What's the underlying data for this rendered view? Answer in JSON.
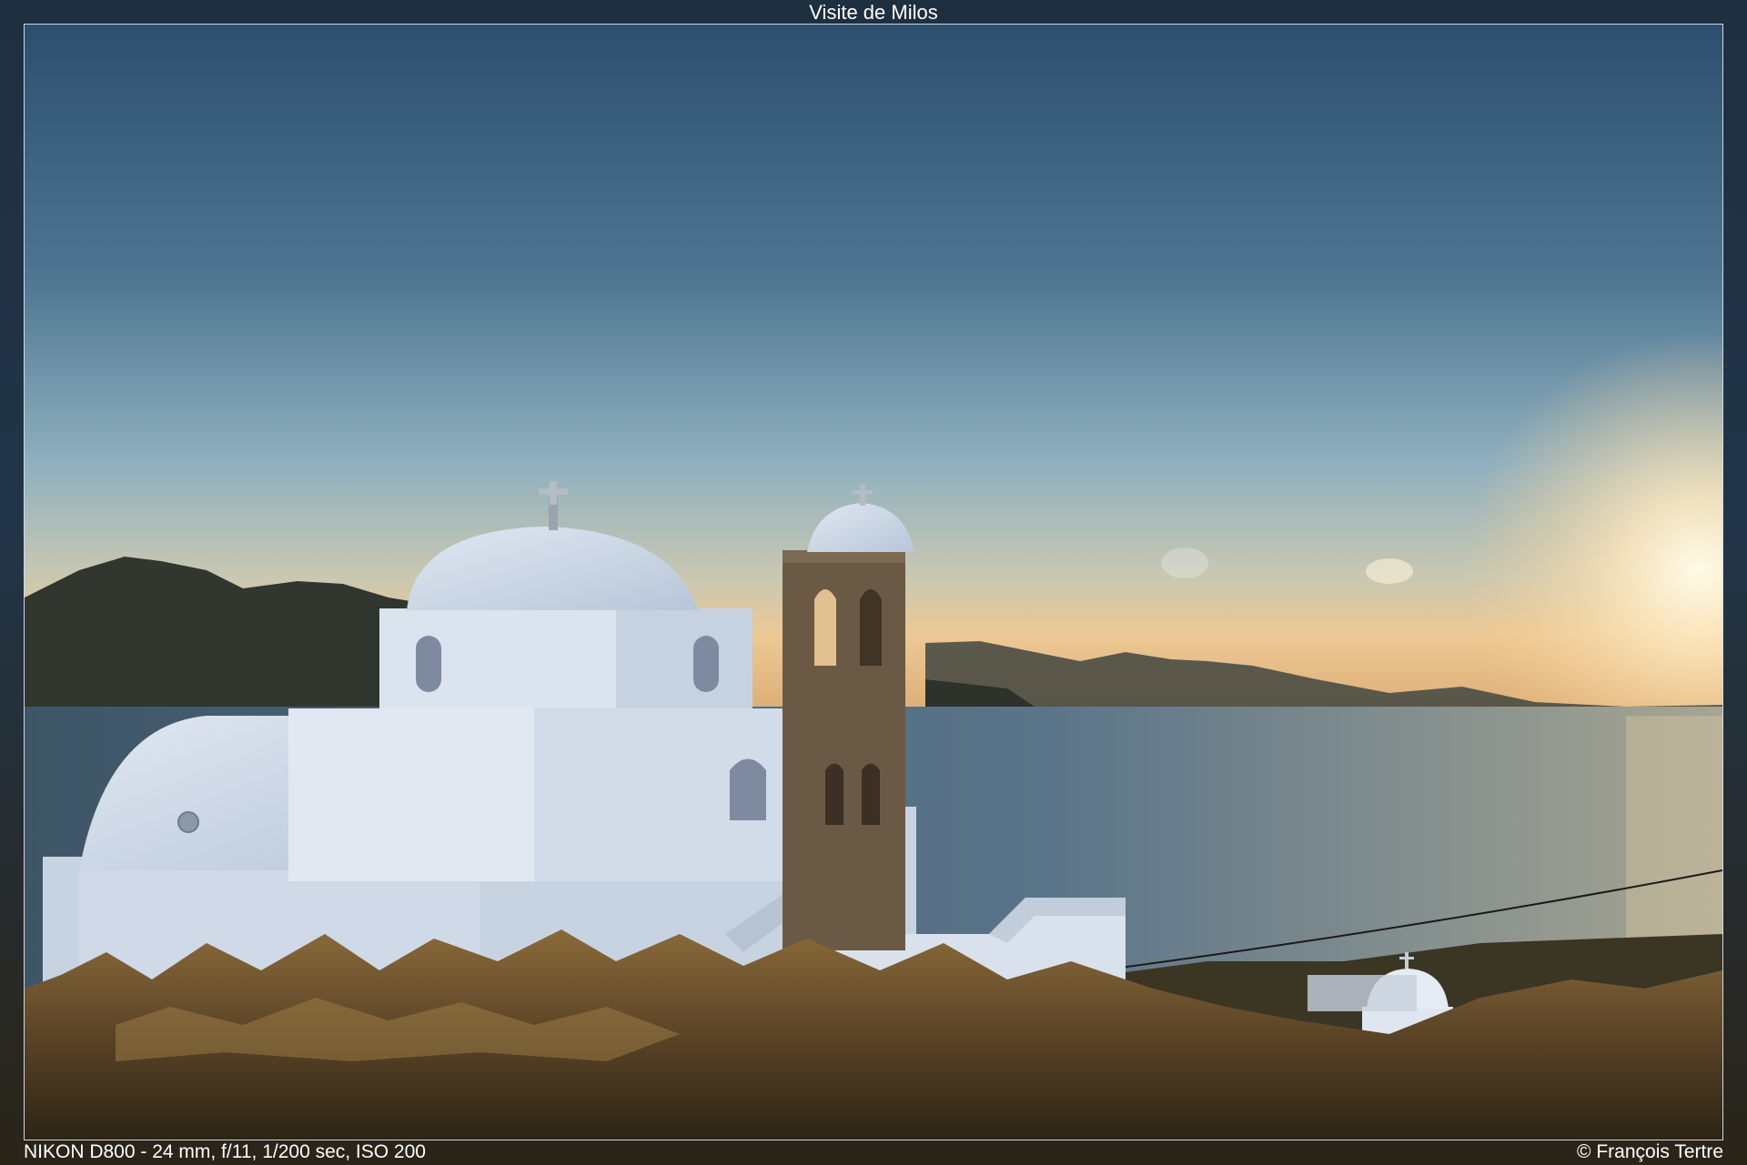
{
  "window": {
    "title": "Visite de Milos"
  },
  "photo": {
    "exif": "NIKON D800 - 24 mm, f/11, 1/200 sec, ISO 200",
    "copyright": "© François Tertre"
  },
  "colors": {
    "sky_top": "#2e5473",
    "sky_mid": "#6f96ae",
    "sky_horizon": "#e6c69a",
    "sun_glow": "#fff3d6",
    "sea": "#4f6a80",
    "hills": "#33382f",
    "church_white": "#e9eef5",
    "church_shadow": "#c3cfdf",
    "stone": "#6b5a44",
    "brush": "#6b5430"
  }
}
